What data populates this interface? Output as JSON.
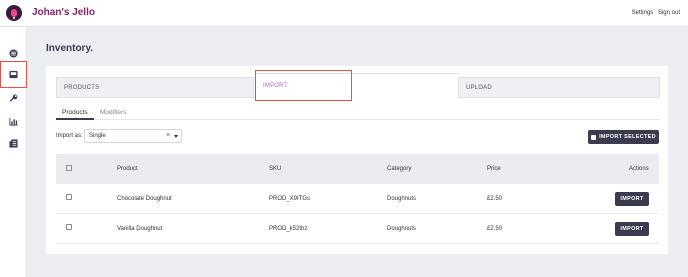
{
  "header": {
    "brand": "Johan's Jello",
    "links": [
      "Settings",
      "Sign out"
    ]
  },
  "sidebar": {
    "icons": [
      "list-icon",
      "inbox-icon",
      "wrench-icon",
      "bar-chart-icon",
      "receipt-icon"
    ],
    "highlighted": "inbox-icon"
  },
  "page": {
    "title": "Inventory."
  },
  "tabs": {
    "products": "PRODUCTS",
    "import": "IMPORT",
    "upload": "UPLOAD"
  },
  "subtabs": {
    "products": "Products",
    "modifiers": "Modifiers"
  },
  "import_as": {
    "label": "Import as:",
    "value": "Single",
    "clear": "×"
  },
  "buttons": {
    "import_selected": "IMPORT SELECTED",
    "row_import": "IMPORT"
  },
  "table": {
    "headers": {
      "product": "Product",
      "sku": "SKU",
      "category": "Category",
      "price": "Price",
      "actions": "Actions"
    },
    "rows": [
      {
        "product": "Chocolate Doughnut",
        "sku": "PROD_X9ITGs",
        "category": "Doughnuts",
        "price": "£2.50"
      },
      {
        "product": "Vanilla Doughnut",
        "sku": "PROD_k52thz",
        "category": "Doughnuts",
        "price": "£2.50"
      }
    ]
  },
  "colors": {
    "brand": "#8e1f6b",
    "button": "#3a3b4f",
    "highlight_outline": "#e0524a",
    "active_tab_text": "#b56ac9"
  }
}
